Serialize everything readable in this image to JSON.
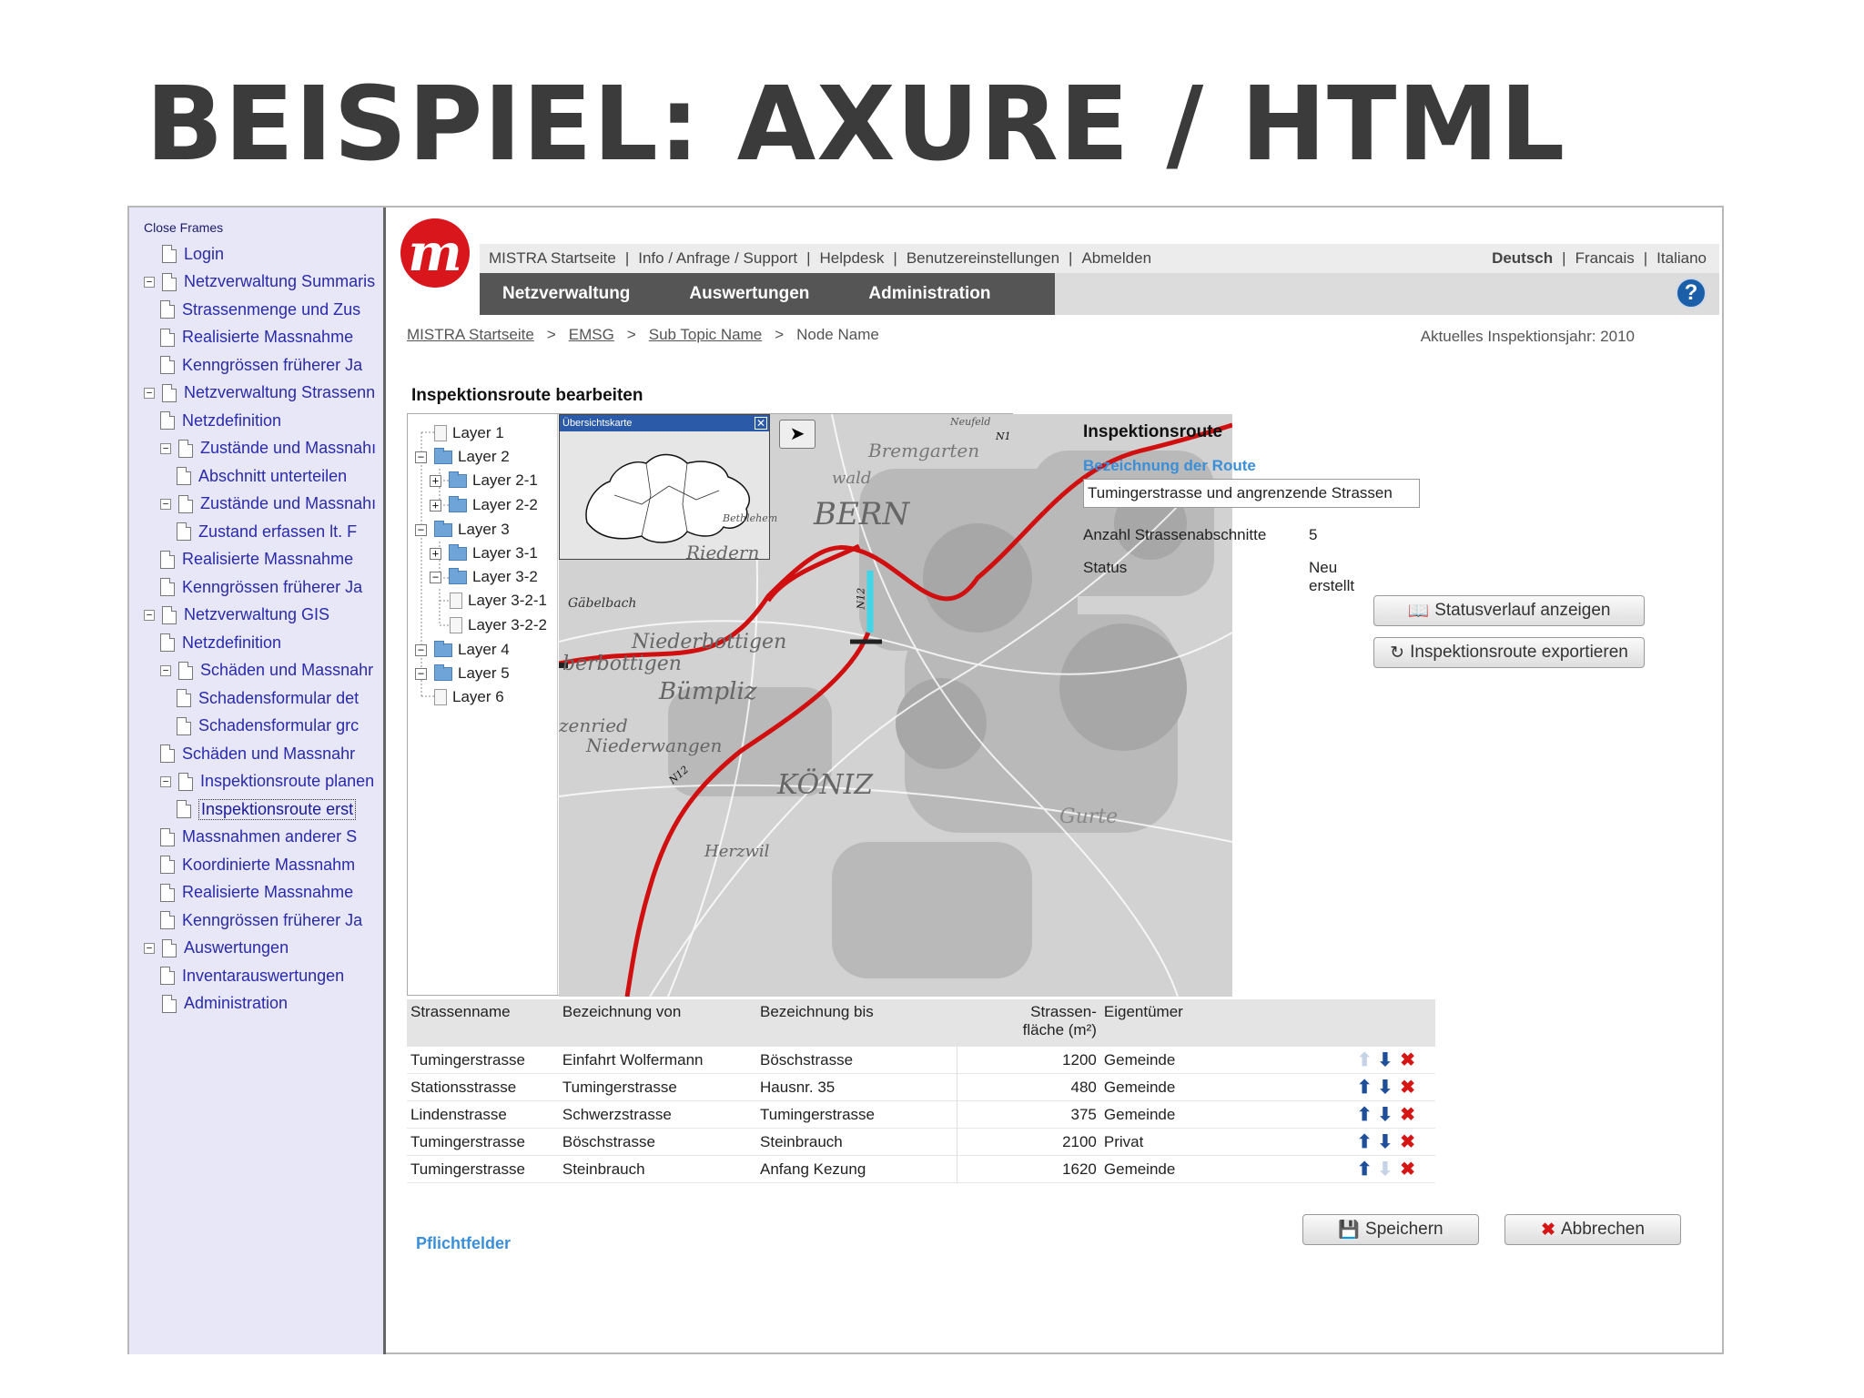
{
  "slide_title": "BEISPIEL: AXURE / HTML",
  "tree": {
    "close_frames": "Close Frames",
    "items": [
      {
        "label": "Login",
        "indent": 1,
        "toggle": ""
      },
      {
        "label": "Netzverwaltung Summaris",
        "indent": 1,
        "toggle": "−"
      },
      {
        "label": "Strassenmenge und Zus",
        "indent": 2,
        "toggle": ""
      },
      {
        "label": "Realisierte Massnahme",
        "indent": 2,
        "toggle": ""
      },
      {
        "label": "Kenngrössen früherer Ja",
        "indent": 2,
        "toggle": ""
      },
      {
        "label": "Netzverwaltung Strassenn",
        "indent": 1,
        "toggle": "−"
      },
      {
        "label": "Netzdefinition",
        "indent": 2,
        "toggle": ""
      },
      {
        "label": "Zustände und Massnahı",
        "indent": 2,
        "toggle": "−"
      },
      {
        "label": "Abschnitt unterteilen",
        "indent": 3,
        "toggle": ""
      },
      {
        "label": "Zustände und Massnahı",
        "indent": 2,
        "toggle": "−"
      },
      {
        "label": "Zustand erfassen lt. F",
        "indent": 3,
        "toggle": ""
      },
      {
        "label": "Realisierte Massnahme",
        "indent": 2,
        "toggle": ""
      },
      {
        "label": "Kenngrössen früherer Ja",
        "indent": 2,
        "toggle": ""
      },
      {
        "label": "Netzverwaltung GIS",
        "indent": 1,
        "toggle": "−"
      },
      {
        "label": "Netzdefinition",
        "indent": 2,
        "toggle": ""
      },
      {
        "label": "Schäden und Massnahr",
        "indent": 2,
        "toggle": "−"
      },
      {
        "label": "Schadensformular det",
        "indent": 3,
        "toggle": ""
      },
      {
        "label": "Schadensformular grc",
        "indent": 3,
        "toggle": ""
      },
      {
        "label": "Schäden und Massnahr",
        "indent": 2,
        "toggle": ""
      },
      {
        "label": "Inspektionsroute planen",
        "indent": 2,
        "toggle": "−"
      },
      {
        "label": "Inspektionsroute erst",
        "indent": 3,
        "toggle": "",
        "active": true
      },
      {
        "label": "Massnahmen anderer S",
        "indent": 2,
        "toggle": ""
      },
      {
        "label": "Koordinierte Massnahm",
        "indent": 2,
        "toggle": ""
      },
      {
        "label": "Realisierte Massnahme",
        "indent": 2,
        "toggle": ""
      },
      {
        "label": "Kenngrössen früherer Ja",
        "indent": 2,
        "toggle": ""
      },
      {
        "label": "Auswertungen",
        "indent": 1,
        "toggle": "−"
      },
      {
        "label": "Inventarauswertungen",
        "indent": 2,
        "toggle": ""
      },
      {
        "label": "Administration",
        "indent": 1,
        "toggle": ""
      }
    ]
  },
  "topbar": {
    "links": [
      "MISTRA Startseite",
      "Info / Anfrage / Support",
      "Helpdesk",
      "Benutzereinstellungen",
      "Abmelden"
    ],
    "languages": [
      "Deutsch",
      "Francais",
      "Italiano"
    ],
    "active_language": "Deutsch"
  },
  "nav": {
    "tabs": [
      "Netzverwaltung",
      "Auswertungen",
      "Administration"
    ]
  },
  "breadcrumb": {
    "items": [
      "MISTRA Startseite",
      "EMSG",
      "Sub Topic Name"
    ],
    "current": "Node Name",
    "separator": ">"
  },
  "inspection_year": "Aktuelles Inspektionsjahr: 2010",
  "section_title": "Inspektionsroute bearbeiten",
  "layers": [
    {
      "label": "Layer 1",
      "level": 0,
      "kind": "leaf",
      "toggle": ""
    },
    {
      "label": "Layer 2",
      "level": 0,
      "kind": "folder",
      "toggle": "−"
    },
    {
      "label": "Layer 2-1",
      "level": 1,
      "kind": "folder",
      "toggle": "+"
    },
    {
      "label": "Layer 2-2",
      "level": 1,
      "kind": "folder",
      "toggle": "+"
    },
    {
      "label": "Layer 3",
      "level": 0,
      "kind": "folder",
      "toggle": "−"
    },
    {
      "label": "Layer 3-1",
      "level": 1,
      "kind": "folder",
      "toggle": "+"
    },
    {
      "label": "Layer 3-2",
      "level": 1,
      "kind": "folder",
      "toggle": "−"
    },
    {
      "label": "Layer 3-2-1",
      "level": 2,
      "kind": "leaf",
      "toggle": ""
    },
    {
      "label": "Layer 3-2-2",
      "level": 2,
      "kind": "leaf",
      "toggle": ""
    },
    {
      "label": "Layer 4",
      "level": 0,
      "kind": "folder",
      "toggle": "−"
    },
    {
      "label": "Layer 5",
      "level": 0,
      "kind": "folder",
      "toggle": "−"
    },
    {
      "label": "Layer 6",
      "level": 0,
      "kind": "leaf",
      "toggle": ""
    }
  ],
  "map": {
    "overview_title": "Übersichtskarte",
    "labels": [
      "BERN",
      "Bremgarten",
      "wald",
      "Riedern",
      "Niederbottigen",
      "berbottigen",
      "Bümpliz",
      "zenried",
      "Niederwangen",
      "KÖNIZ",
      "Gurte",
      "Herzwil",
      "Gäbelbach",
      "N1",
      "N12",
      "N12",
      "Neufeld",
      "Bethlehem"
    ]
  },
  "route_panel": {
    "title": "Inspektionsroute",
    "name_label": "Bezeichnung der Route",
    "name_value": "Tumingerstrasse und angrenzende Strassen",
    "count_label": "Anzahl Strassenabschnitte",
    "count_value": "5",
    "status_label": "Status",
    "status_value": "Neu erstellt",
    "btn_history": "Statusverlauf anzeigen",
    "btn_export": "Inspektionsroute exportieren"
  },
  "table": {
    "headers": [
      "Strassenname",
      "Bezeichnung von",
      "Bezeichnung bis",
      "Strassen-\nfläche (m²)",
      "Eigentümer"
    ],
    "rows": [
      [
        "Tumingerstrasse",
        "Einfahrt Wolfermann",
        "Böschstrasse",
        "1200",
        "Gemeinde"
      ],
      [
        "Stationsstrasse",
        "Tumingerstrasse",
        "Hausnr. 35",
        "480",
        "Gemeinde"
      ],
      [
        "Lindenstrasse",
        "Schwerzstrasse",
        "Tumingerstrasse",
        "375",
        "Gemeinde"
      ],
      [
        "Tumingerstrasse",
        "Böschstrasse",
        "Steinbrauch",
        "2100",
        "Privat"
      ],
      [
        "Tumingerstrasse",
        "Steinbrauch",
        "Anfang Kezung",
        "1620",
        "Gemeinde"
      ]
    ],
    "up_enabled": [
      false,
      true,
      true,
      true,
      true
    ],
    "down_enabled": [
      true,
      true,
      true,
      true,
      false
    ]
  },
  "footer": {
    "required": "Pflichtfelder",
    "save": "Speichern",
    "cancel": "Abbrechen"
  },
  "colors": {
    "accent": "#d8161b",
    "nav_dark": "#555555",
    "link_blue": "#3b8fd8",
    "route_red": "#d01010",
    "route_cyan": "#3fd7e8"
  }
}
